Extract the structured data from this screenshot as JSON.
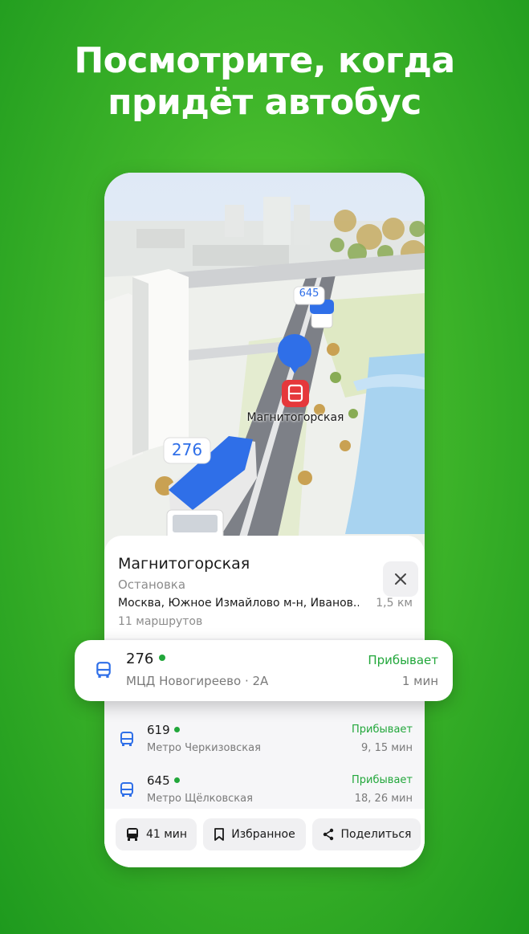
{
  "headline": {
    "line1": "Посмотрите, когда",
    "line2": "придёт автобус"
  },
  "map": {
    "bus_far_label": "645",
    "bus_near_label": "276",
    "stop_label": "Магнитогорская"
  },
  "stop": {
    "title": "Магнитогорская",
    "type": "Остановка",
    "address": "Москва, Южное Измайлово м-н, Иванов...",
    "distance": "1,5 км",
    "routes_count": "11 маршрутов"
  },
  "highlighted_route": {
    "number": "276",
    "destination": "МЦД Новогиреево · 2А",
    "status": "Прибывает",
    "time": "1 мин"
  },
  "routes": [
    {
      "number": "619",
      "destination": "Метро Черкизовская",
      "status": "Прибывает",
      "time": "9, 15 мин"
    },
    {
      "number": "645",
      "destination": "Метро Щёлковская",
      "status": "Прибывает",
      "time": "18, 26 мин"
    }
  ],
  "actions": {
    "travel_time": "41 мин",
    "favorite": "Избранное",
    "share": "Поделиться"
  },
  "colors": {
    "background": "#3fb52a",
    "arrival_green": "#22a73b",
    "bus_blue": "#2f6fe8",
    "stop_red": "#e5383b"
  },
  "icons": [
    "bus-icon",
    "close-icon",
    "bookmark-icon",
    "share-icon",
    "location-pin-icon"
  ]
}
